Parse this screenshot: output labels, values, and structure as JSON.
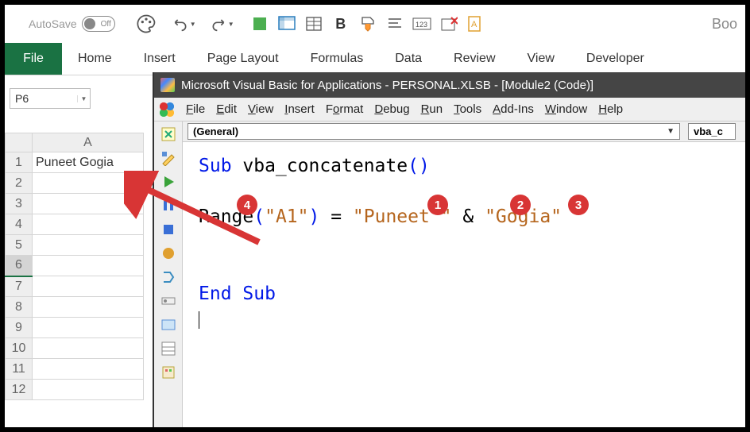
{
  "qat": {
    "autosave_label": "AutoSave",
    "autosave_state": "Off",
    "book_fragment": "Boo"
  },
  "ribbon": {
    "file": "File",
    "tabs": [
      "Home",
      "Insert",
      "Page Layout",
      "Formulas",
      "Data",
      "Review",
      "View",
      "Developer"
    ]
  },
  "namebox": {
    "value": "P6"
  },
  "grid": {
    "col_header": "A",
    "rows": [
      "1",
      "2",
      "3",
      "4",
      "5",
      "6",
      "7",
      "8",
      "9",
      "10",
      "11",
      "12"
    ],
    "a1_value": "Puneet Gogia",
    "selected_row": "6"
  },
  "vbe": {
    "title": "Microsoft Visual Basic for Applications - PERSONAL.XLSB - [Module2 (Code)]",
    "menu": [
      "File",
      "Edit",
      "View",
      "Insert",
      "Format",
      "Debug",
      "Run",
      "Tools",
      "Add-Ins",
      "Window",
      "Help"
    ],
    "object_combo": "(General)",
    "proc_combo": "vba_c",
    "code": {
      "sub_kw": "Sub ",
      "sub_name": "vba_concatenate",
      "paren": "()",
      "range_fn": "Range",
      "open_p": "(",
      "a1_str": "\"A1\"",
      "close_p": ")",
      "eq": " = ",
      "str1": "\"Puneet \"",
      "amp": " & ",
      "str2": "\"Gogia\"",
      "end_sub": "End Sub"
    }
  },
  "annotations": {
    "b1": "1",
    "b2": "2",
    "b3": "3",
    "b4": "4"
  }
}
